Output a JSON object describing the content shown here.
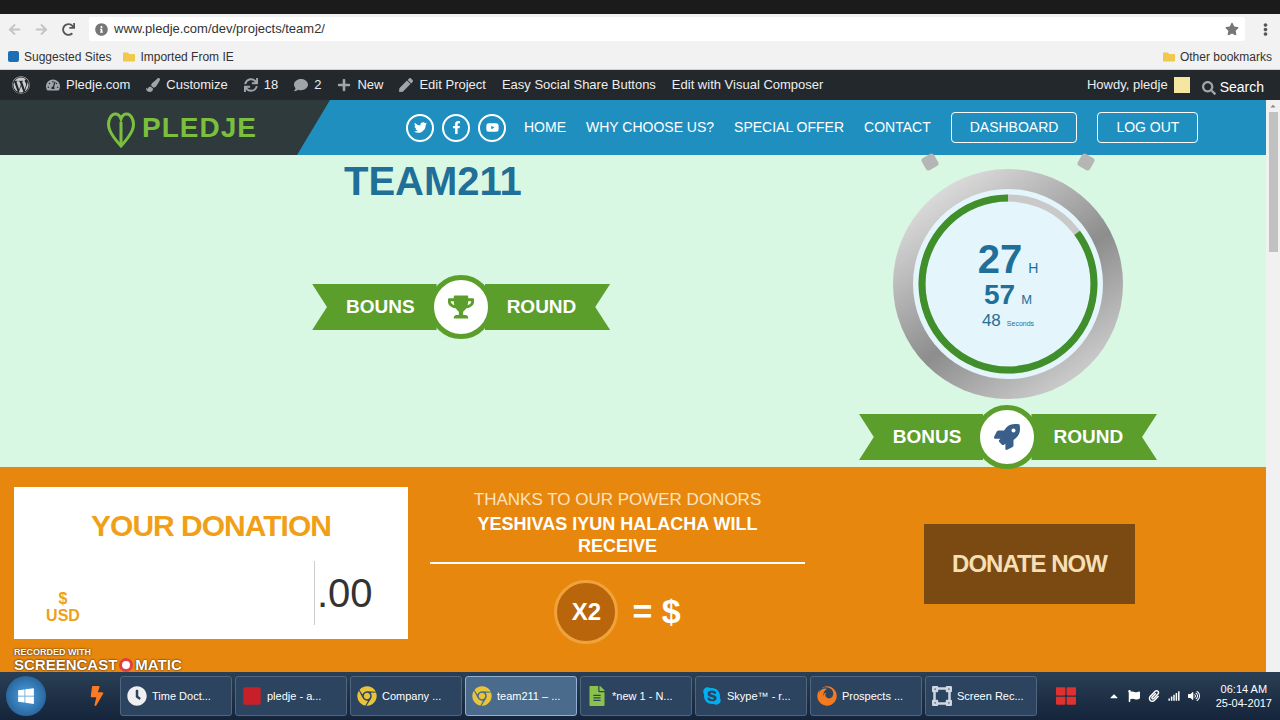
{
  "browser": {
    "url": "www.pledje.com/dev/projects/team2/",
    "bookmarks": [
      "Suggested Sites",
      "Imported From IE"
    ],
    "other_bookmarks": "Other bookmarks"
  },
  "admin_bar": {
    "items": [
      "Pledje.com",
      "Customize",
      "18",
      "2",
      "New",
      "Edit Project",
      "Easy Social Share Buttons",
      "Edit with Visual Composer"
    ],
    "greeting": "Howdy, pledje",
    "search": "Search"
  },
  "site_header": {
    "logo": "PLEDJE",
    "nav": [
      {
        "label": "HOME",
        "kind": "link"
      },
      {
        "label": "WHY CHOOSE US?",
        "kind": "link"
      },
      {
        "label": "SPECIAL OFFER",
        "kind": "link"
      },
      {
        "label": "CONTACT",
        "kind": "link"
      },
      {
        "label": "DASHBOARD",
        "kind": "button"
      },
      {
        "label": "LOG OUT",
        "kind": "button"
      }
    ]
  },
  "project": {
    "title": "TEAM211",
    "ribbon": {
      "left": "BOUNS",
      "right": "ROUND"
    },
    "timer": {
      "hours": "27",
      "hours_unit": "H",
      "minutes": "57",
      "minutes_unit": "M",
      "seconds": "48",
      "seconds_unit": "Seconds",
      "level": 0.85
    },
    "timer_ribbon": {
      "left": "BONUS",
      "right": "ROUND"
    }
  },
  "donation": {
    "title": "YOUR DONATION",
    "currency_symbol": "$",
    "currency": "USD",
    "amount": ".00",
    "thanks": "THANKS TO OUR POWER DONORS",
    "receiver": "YESHIVAS IYUN HALACHA WILL RECEIVE",
    "multiplier": "X2",
    "result": "= $",
    "button": "DONATE NOW"
  },
  "watermark": {
    "line1": "RECORDED WITH",
    "brand_left": "SCREENCAST",
    "brand_right": "MATIC"
  },
  "taskbar": {
    "items": [
      {
        "label": "Time Doct...",
        "selected": false
      },
      {
        "label": "pledje - a...",
        "selected": false
      },
      {
        "label": "Company ...",
        "selected": false
      },
      {
        "label": "team211 – ...",
        "selected": true
      },
      {
        "label": "*new 1 - N...",
        "selected": false
      },
      {
        "label": "Skype™ - r...",
        "selected": false
      },
      {
        "label": "Prospects ...",
        "selected": false
      },
      {
        "label": "Screen Rec...",
        "selected": false
      }
    ],
    "time": "06:14 AM",
    "date": "25-04-2017"
  }
}
